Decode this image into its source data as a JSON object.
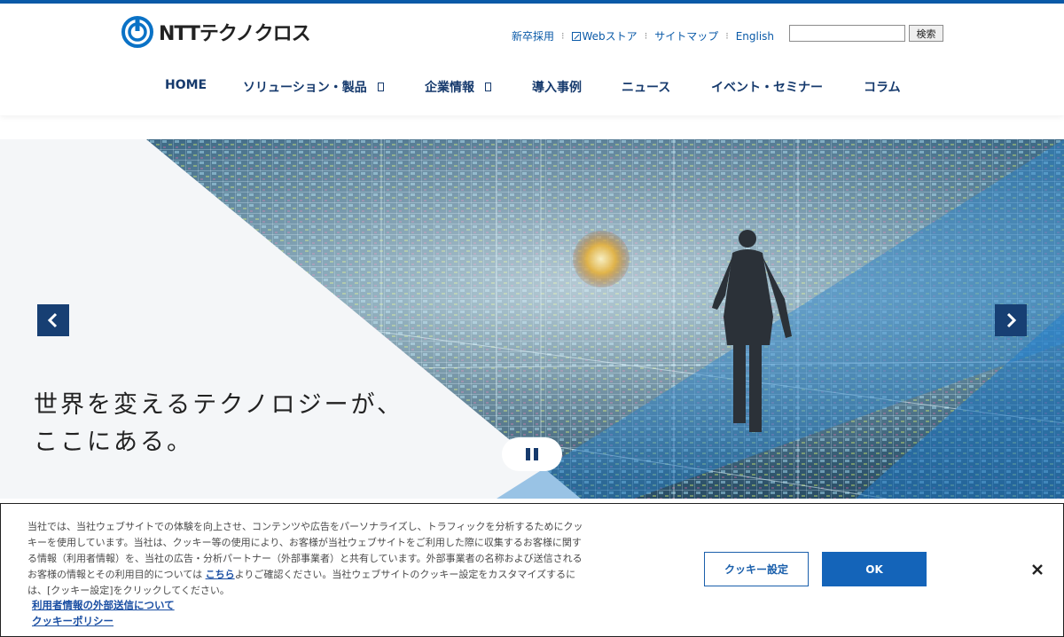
{
  "brand": {
    "name": "NTTテクノクロス",
    "accent": "#0a5aa8",
    "navy": "#173f73"
  },
  "utility": {
    "links": [
      "新卒採用",
      "Webストア",
      "サイトマップ",
      "English"
    ],
    "search_button": "検索",
    "search_value": ""
  },
  "nav": {
    "items": [
      "HOME",
      "ソリューション・製品",
      "企業情報",
      "導入事例",
      "ニュース",
      "イベント・セミナー",
      "コラム"
    ]
  },
  "hero": {
    "line1": "世界を変えるテクノロジーが、",
    "line2": "ここにある。",
    "prev_icon": "chevron-left-icon",
    "next_icon": "chevron-right-icon",
    "pause_icon": "pause-icon"
  },
  "cookie": {
    "text_before_link": "当社では、当社ウェブサイトでの体験を向上させ、コンテンツや広告をパーソナライズし、トラフィックを分析するためにクッキーを使用しています。当社は、クッキー等の使用により、お客様が当社ウェブサイトをご利用した際に収集するお客様に関する情報（利用者情報）を、当社の広告・分析パートナー（外部事業者）と共有しています。外部事業者の名称および送信されるお客様の情報とその利用目的については ",
    "inline_link": "こちら",
    "text_after_link": "よりご確認ください。当社ウェブサイトのクッキー設定をカスタマイズするには、[クッキー設定]をクリックしてください。",
    "link1": "利用者情報の外部送信について",
    "link2": "クッキーポリシー",
    "settings_button": "クッキー設定",
    "ok_button": "OK",
    "close_icon": "close-icon"
  }
}
